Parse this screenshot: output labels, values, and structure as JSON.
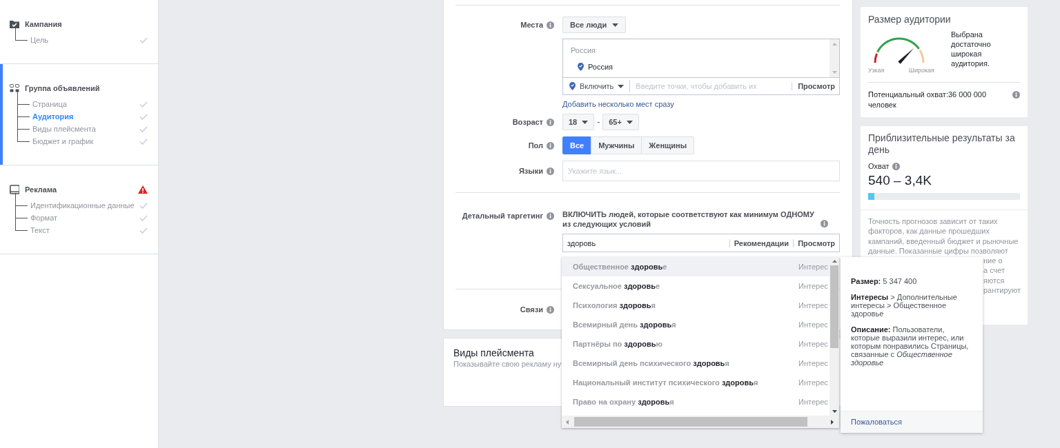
{
  "sidebar": {
    "sections": [
      {
        "title": "Кампания",
        "active": false,
        "warning": false,
        "items": [
          {
            "label": "Цель",
            "selected": false,
            "complete": true
          }
        ]
      },
      {
        "title": "Группа объявлений",
        "active": true,
        "warning": false,
        "items": [
          {
            "label": "Страница",
            "selected": false,
            "complete": true
          },
          {
            "label": "Аудитория",
            "selected": true,
            "complete": true
          },
          {
            "label": "Виды плейсмента",
            "selected": false,
            "complete": true
          },
          {
            "label": "Бюджет и график",
            "selected": false,
            "complete": true
          }
        ]
      },
      {
        "title": "Реклама",
        "active": false,
        "warning": true,
        "items": [
          {
            "label": "Идентификационные данные",
            "selected": false,
            "complete": true
          },
          {
            "label": "Формат",
            "selected": false,
            "complete": true
          },
          {
            "label": "Текст",
            "selected": false,
            "complete": true
          }
        ]
      }
    ]
  },
  "audience_form": {
    "locations": {
      "label": "Места",
      "dropdown": "Все люди",
      "group_heading": "Россия",
      "items": [
        "Россия"
      ],
      "mode": "Включить",
      "placeholder": "Введите точки, чтобы добавить их",
      "browse": "Просмотр",
      "bulk_link": "Добавить несколько мест сразу"
    },
    "age": {
      "label": "Возраст",
      "min": "18",
      "separator": "-",
      "max": "65+"
    },
    "gender": {
      "label": "Пол",
      "options": [
        {
          "label": "Все",
          "selected": true
        },
        {
          "label": "Мужчины",
          "selected": false
        },
        {
          "label": "Женщины",
          "selected": false
        }
      ]
    },
    "languages": {
      "label": "Языки",
      "placeholder": "Укажите язык..."
    },
    "detailed_targeting": {
      "label": "Детальный таргетинг",
      "instruction": "ВКЛЮЧИТЬ людей, которые соответствуют как минимум ОДНОМУ из следующих условий",
      "value": "здоровь",
      "suggestions_button": "Рекомендации",
      "browse": "Просмотр"
    },
    "connections": {
      "label": "Связи"
    }
  },
  "placements_card": {
    "title": "Виды плейсмента",
    "subtitle": "Показывайте свою рекламу ну"
  },
  "audience_size": {
    "title": "Размер аудитории",
    "narrow_label": "Узкая",
    "broad_label": "Широкая",
    "verdict": "Выбрана достаточно широкая аудитория.",
    "potential_reach": "Потенциальный охват:36 000 000 человек"
  },
  "estimated_results": {
    "title": "Приблизительные результаты за день",
    "reach_label": "Охват",
    "reach_value": "540 – 3,4K",
    "level": 0.04,
    "note_lines": [
      "Точность прогнозов зависит от таких",
      "факторов, как данные прошедших",
      "кампаний, введенный бюджет и рыночные",
      "данные. Показанные цифры позволяют"
    ],
    "note_fragments": [
      "ние о",
      "а счет",
      "яются",
      "рантируют"
    ]
  },
  "suggestions": [
    {
      "text": "Общественное **здоровь**е",
      "category": "Интерес",
      "selected": true
    },
    {
      "text": "Сексуальное **здоровь**е",
      "category": "Интерес",
      "selected": false
    },
    {
      "text": "Психология **здоровь**я",
      "category": "Интерес",
      "selected": false
    },
    {
      "text": "Всемирный день **здоровь**я",
      "category": "Интерес",
      "selected": false
    },
    {
      "text": "Партнёры по **здоровь**ю",
      "category": "Интерес",
      "selected": false
    },
    {
      "text": "Всемирный день психического **здоровь**я",
      "category": "Интерес",
      "selected": false
    },
    {
      "text": "Национальный институт психического **здоровь**я",
      "category": "Интерес",
      "selected": false
    },
    {
      "text": "Право на охрану **здоровь**я",
      "category": "Интерес",
      "selected": false
    }
  ],
  "details_tooltip": {
    "size": "**Размер:** 5 347 400",
    "path": "**Интересы** > Дополнительные интересы > Общественное здоровье",
    "description": "**Описание:** Пользователи, которые выразили интерес, или которым понравились Страницы, связанные с *Общественное здоровье*",
    "report_link": "Пожаловаться"
  }
}
